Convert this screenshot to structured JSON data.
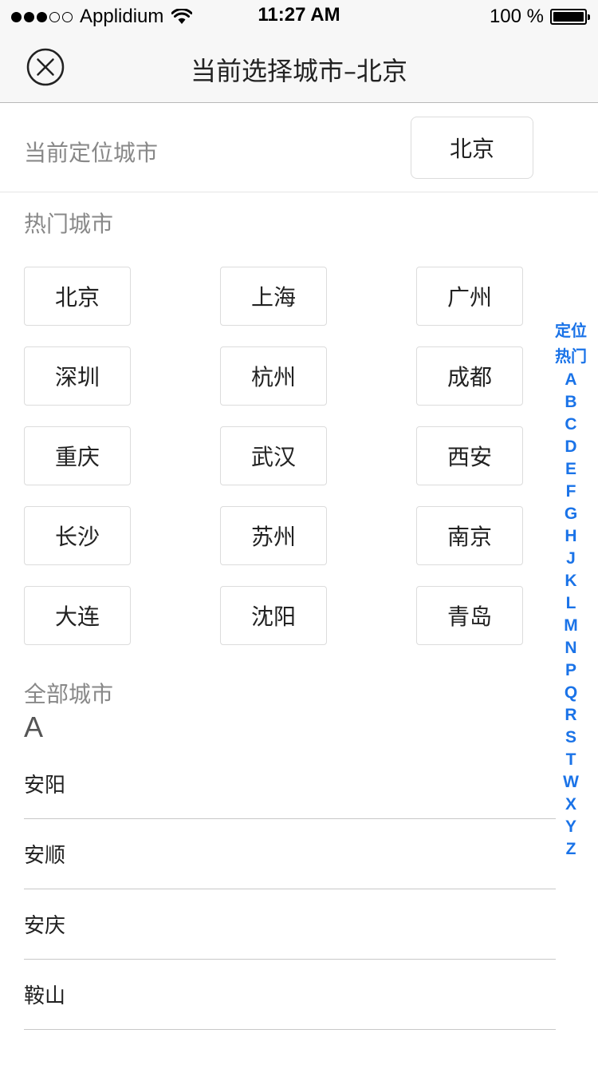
{
  "status_bar": {
    "carrier": "Applidium",
    "time": "11:27 AM",
    "battery": "100 %",
    "signal_bars_filled": 3,
    "signal_bars_total": 5
  },
  "nav": {
    "title": "当前选择城市–北京",
    "close_icon": "close-circle-icon"
  },
  "current_location": {
    "label": "当前定位城市",
    "city": "北京"
  },
  "hot_cities": {
    "title": "热门城市",
    "items": [
      "北京",
      "上海",
      "广州",
      "深圳",
      "杭州",
      "成都",
      "重庆",
      "武汉",
      "西安",
      "长沙",
      "苏州",
      "南京",
      "大连",
      "沈阳",
      "青岛"
    ]
  },
  "all_cities": {
    "title": "全部城市",
    "groups": [
      {
        "letter": "A",
        "cities": [
          "安阳",
          "安顺",
          "安庆",
          "鞍山"
        ]
      }
    ]
  },
  "index": [
    "定位",
    "热门",
    "A",
    "B",
    "C",
    "D",
    "E",
    "F",
    "G",
    "H",
    "J",
    "K",
    "L",
    "M",
    "N",
    "P",
    "Q",
    "R",
    "S",
    "T",
    "W",
    "X",
    "Y",
    "Z"
  ],
  "colors": {
    "accent": "#1a73e8",
    "bar_background": "#f7f7f7",
    "muted_text": "#888888"
  }
}
